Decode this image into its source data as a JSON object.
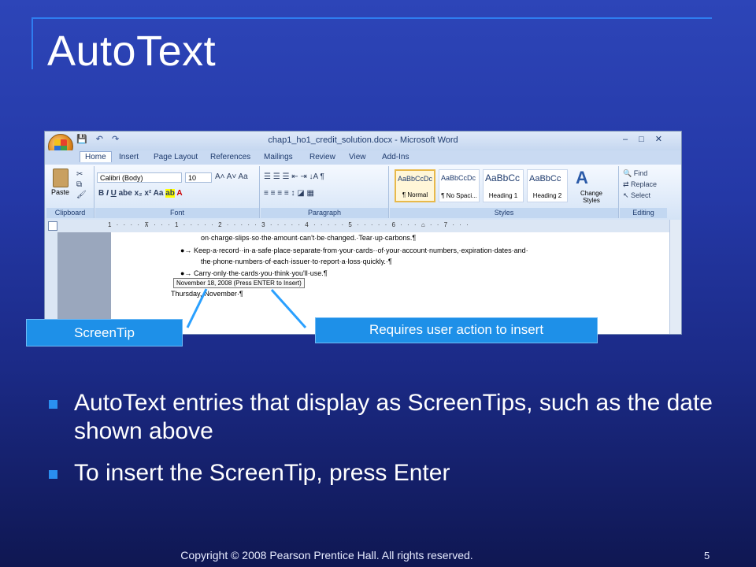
{
  "slide": {
    "title": "AutoText",
    "bullets": [
      "AutoText entries that display as ScreenTips, such as the date shown above",
      "To insert the ScreenTip, press Enter"
    ],
    "footer": "Copyright © 2008 Pearson Prentice Hall. All rights reserved.",
    "page_number": "5"
  },
  "callouts": {
    "screentip": "ScreenTip",
    "user_action": "Requires user action to insert"
  },
  "word": {
    "window_title": "chap1_ho1_credit_solution.docx - Microsoft Word",
    "tabs": [
      "Home",
      "Insert",
      "Page Layout",
      "References",
      "Mailings",
      "Review",
      "View",
      "Add-Ins"
    ],
    "groups": {
      "clipboard": "Clipboard",
      "font": "Font",
      "paragraph": "Paragraph",
      "styles": "Styles",
      "editing": "Editing"
    },
    "paste_label": "Paste",
    "font_name": "Calibri (Body)",
    "font_size": "10",
    "styles": [
      {
        "sample": "AaBbCcDc",
        "name": "¶ Normal"
      },
      {
        "sample": "AaBbCcDc",
        "name": "¶ No Spaci..."
      },
      {
        "sample": "AaBbCc",
        "name": "Heading 1"
      },
      {
        "sample": "AaBbCc",
        "name": "Heading 2"
      }
    ],
    "change_styles": "Change Styles",
    "editing": {
      "find": "Find",
      "replace": "Replace",
      "select": "Select"
    },
    "doc_lines": [
      "on·charge·slips·so·the·amount·can't·be·changed.·Tear·up·carbons.¶",
      "Keep·a·record··in·a·safe·place·separate·from·your·cards··of·your·account·numbers,·expiration·dates·and·",
      "the·phone·numbers·of·each·issuer·to·report·a·loss·quickly.·¶",
      "Carry·only·the·cards·you·think·you'll·use.¶",
      "Thursday,·November·¶"
    ],
    "tooltip": "November 18, 2008  (Press ENTER to Insert)"
  },
  "colors": {
    "background_top": "#2d45b8",
    "background_bottom": "#0f1752",
    "callout": "#1e90e8",
    "bullet": "#2a8ff0",
    "accent_line": "#2f7df0"
  }
}
